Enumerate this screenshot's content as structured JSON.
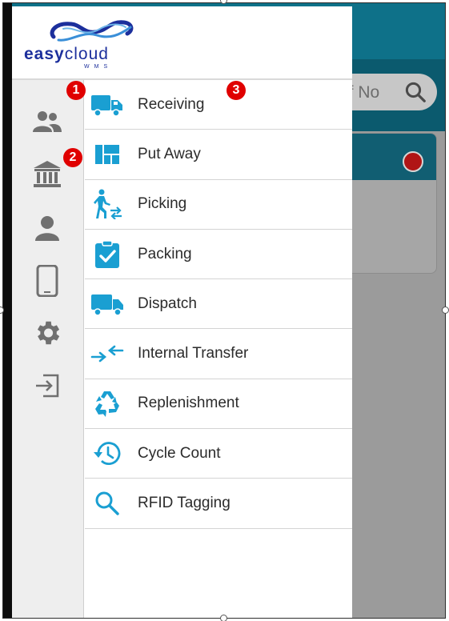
{
  "logo": {
    "main": "easy",
    "accent": "cloud",
    "sub": "WMS"
  },
  "background": {
    "search_placeholder": "ef No",
    "colors": {
      "header": "#0e7189",
      "status_dot": "#b01515"
    }
  },
  "rail": {
    "items": [
      {
        "icon": "users-icon"
      },
      {
        "icon": "bank-icon"
      },
      {
        "icon": "user-icon"
      },
      {
        "icon": "phone-icon"
      },
      {
        "icon": "settings-icon"
      },
      {
        "icon": "logout-icon"
      }
    ]
  },
  "menu": {
    "items": [
      {
        "label": "Receiving",
        "icon": "truck-icon"
      },
      {
        "label": "Put Away",
        "icon": "shelves-icon"
      },
      {
        "label": "Picking",
        "icon": "walking-person-transfer-icon"
      },
      {
        "label": "Packing",
        "icon": "clipboard-check-icon"
      },
      {
        "label": "Dispatch",
        "icon": "delivery-truck-icon"
      },
      {
        "label": "Internal Transfer",
        "icon": "arrows-inward-icon"
      },
      {
        "label": "Replenishment",
        "icon": "recycle-icon"
      },
      {
        "label": "Cycle Count",
        "icon": "history-icon"
      },
      {
        "label": "RFID Tagging",
        "icon": "search-icon"
      }
    ]
  },
  "callouts": [
    "1",
    "2",
    "3"
  ],
  "colors": {
    "accent": "#1a9fd2",
    "rail_icon": "#707070",
    "callout": "#e00000"
  }
}
